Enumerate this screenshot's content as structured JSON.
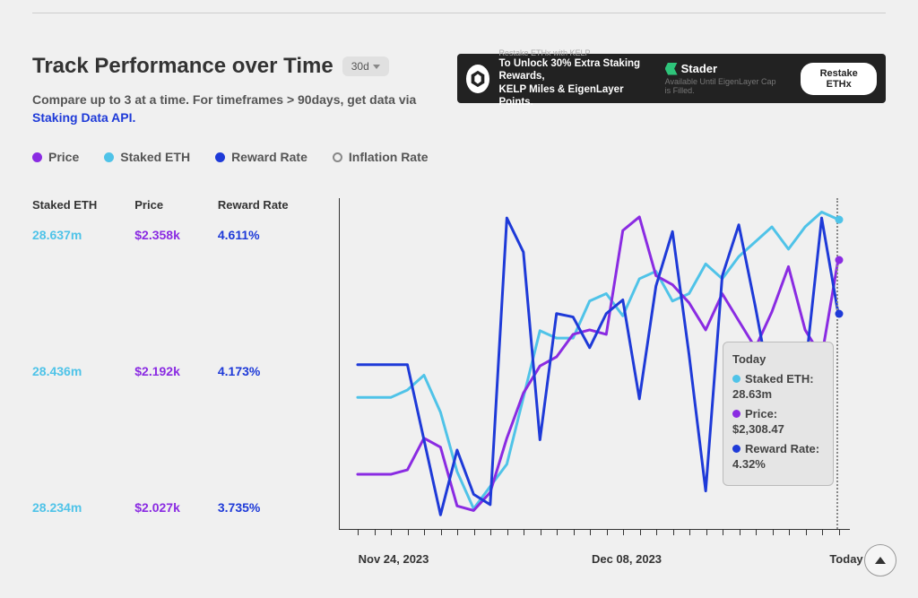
{
  "header": {
    "title": "Track Performance over Time",
    "timeframe_label": "30d",
    "subtitle_prefix": "Compare up to 3 at a time. For timeframes > 90days, get data via ",
    "subtitle_link": "Staking Data API."
  },
  "ad": {
    "small": "Restake ETHx with KELP",
    "line1": "To Unlock 30% Extra Staking Rewards,",
    "line2": "KELP Miles & EigenLayer Points.",
    "brand": "Stader",
    "caption": "Available Until EigenLayer Cap is Filled.",
    "cta": "Restake ETHx"
  },
  "legend": {
    "price": "Price",
    "staked": "Staked ETH",
    "reward": "Reward Rate",
    "inflation": "Inflation Rate"
  },
  "axis_headers": {
    "staked": "Staked ETH",
    "price": "Price",
    "reward": "Reward Rate"
  },
  "axis_values": {
    "staked": {
      "top": "28.637m",
      "mid": "28.436m",
      "bot": "28.234m"
    },
    "price": {
      "top": "$2.358k",
      "mid": "$2.192k",
      "bot": "$2.027k"
    },
    "reward": {
      "top": "4.611%",
      "mid": "4.173%",
      "bot": "3.735%"
    }
  },
  "x_labels": {
    "l1": "Nov 24, 2023",
    "l2": "Dec 08, 2023",
    "l3": "Today"
  },
  "tooltip": {
    "title": "Today",
    "staked_label": "Staked ETH:",
    "staked_value": "28.63m",
    "price_label": "Price:",
    "price_value": "$2,308.47",
    "reward_label": "Reward Rate:",
    "reward_value": "4.32%"
  },
  "colors": {
    "price": "#8a2be2",
    "staked": "#4fc3e8",
    "reward": "#1e3ad8",
    "inflation": "#888888"
  },
  "chart_data": {
    "type": "line",
    "x_label_positions": [
      "Nov 24, 2023",
      "Dec 08, 2023",
      "Today"
    ],
    "x": [
      0,
      1,
      2,
      3,
      4,
      5,
      6,
      7,
      8,
      9,
      10,
      11,
      12,
      13,
      14,
      15,
      16,
      17,
      18,
      19,
      20,
      21,
      22,
      23,
      24,
      25,
      26,
      27,
      28,
      29
    ],
    "series": [
      {
        "name": "Staked ETH",
        "unit": "m",
        "ylim": [
          28.234,
          28.637
        ],
        "values": [
          28.39,
          28.39,
          28.39,
          28.4,
          28.42,
          28.37,
          28.29,
          28.24,
          28.27,
          28.3,
          28.39,
          28.48,
          28.47,
          28.47,
          28.52,
          28.53,
          28.5,
          28.55,
          28.56,
          28.52,
          28.53,
          28.57,
          28.55,
          28.58,
          28.6,
          28.62,
          28.59,
          28.62,
          28.64,
          28.63
        ],
        "today_value": 28.63
      },
      {
        "name": "Price",
        "unit": "$k",
        "ylim": [
          2.027,
          2.358
        ],
        "values": [
          2.07,
          2.07,
          2.07,
          2.075,
          2.11,
          2.1,
          2.035,
          2.03,
          2.05,
          2.11,
          2.16,
          2.19,
          2.2,
          2.225,
          2.23,
          2.225,
          2.34,
          2.355,
          2.29,
          2.28,
          2.26,
          2.23,
          2.27,
          2.24,
          2.21,
          2.25,
          2.3,
          2.23,
          2.2,
          2.308
        ],
        "today_value": 2.30847
      },
      {
        "name": "Reward Rate",
        "unit": "%",
        "ylim": [
          3.735,
          4.611
        ],
        "values": [
          4.17,
          4.17,
          4.17,
          4.17,
          3.95,
          3.73,
          3.92,
          3.79,
          3.76,
          4.6,
          4.5,
          3.95,
          4.32,
          4.31,
          4.22,
          4.32,
          4.36,
          4.07,
          4.4,
          4.56,
          4.2,
          3.8,
          4.43,
          4.58,
          4.34,
          4.08,
          4.21,
          4.15,
          4.6,
          4.32
        ],
        "today_value": 4.32
      }
    ]
  }
}
